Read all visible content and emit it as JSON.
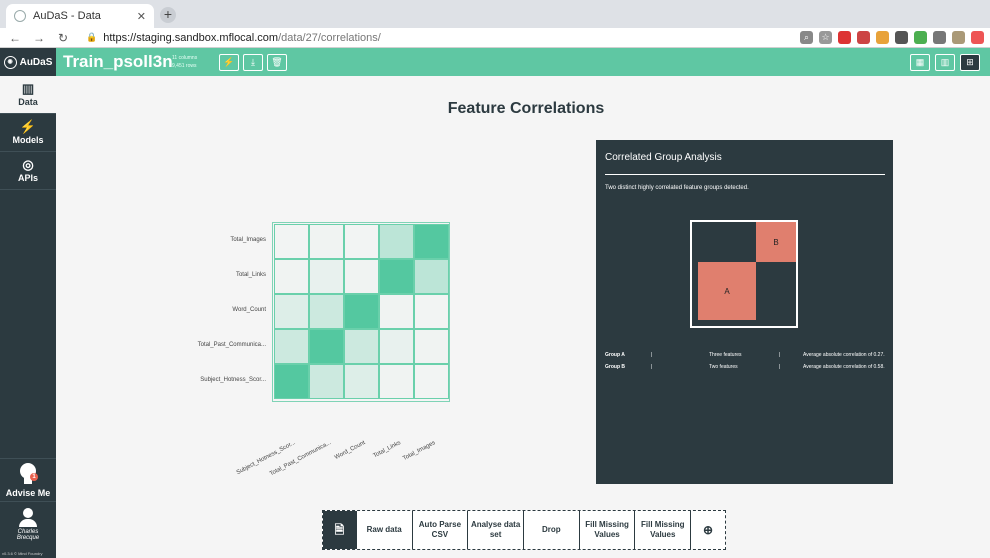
{
  "browser": {
    "tab_title": "AuDaS - Data",
    "url_host": "https://staging.sandbox.mflocal.com",
    "url_path": "/data/27/correlations/"
  },
  "app": {
    "logo": "AuDaS",
    "dataset_title": "Train_psoll3n",
    "meta_line1": "11 columns",
    "meta_line2": "9,451 rows",
    "header_buttons": [
      "bolt-icon",
      "download-icon",
      "trash-icon"
    ],
    "view_buttons": [
      "grid-icon",
      "chart-icon",
      "correlation-icon"
    ]
  },
  "sidebar": {
    "items": [
      {
        "label": "Data",
        "icon": "chart-icon"
      },
      {
        "label": "Models",
        "icon": "bolt-icon"
      },
      {
        "label": "APIs",
        "icon": "globe-icon"
      }
    ],
    "advise": "Advise Me",
    "advise_badge": "1",
    "user_line1": "Charles",
    "user_line2": "Brecque",
    "version": "v0.3.6 © Mind Foundry"
  },
  "main": {
    "title": "Feature Correlations"
  },
  "chart_data": {
    "type": "heatmap",
    "rows": [
      "Total_Images",
      "Total_Links",
      "Word_Count",
      "Total_Past_Communica...",
      "Subject_Hotness_Scor..."
    ],
    "columns": [
      "Subject_Hotness_Scor...",
      "Total_Past_Communica...",
      "Word_Count",
      "Total_Links",
      "Total_Images"
    ],
    "values": [
      [
        0.02,
        0.03,
        0.02,
        0.35,
        1.0
      ],
      [
        0.03,
        0.08,
        0.03,
        1.0,
        0.35
      ],
      [
        0.15,
        0.25,
        1.0,
        0.03,
        0.02
      ],
      [
        0.25,
        1.0,
        0.25,
        0.08,
        0.03
      ],
      [
        1.0,
        0.25,
        0.15,
        0.03,
        0.02
      ]
    ],
    "color": "#54c8a0"
  },
  "panel": {
    "title": "Correlated Group Analysis",
    "description": "Two distinct highly correlated feature groups detected.",
    "groups": [
      {
        "label": "A",
        "name": "Group A",
        "sep": "|",
        "count": "Three features",
        "sep2": "|",
        "avg": "Average absolute correlation of 0.27."
      },
      {
        "label": "B",
        "name": "Group B",
        "sep": "|",
        "count": "Two features",
        "sep2": "|",
        "avg": "Average absolute correlation of 0.58."
      }
    ],
    "group_color": "#e07f6e"
  },
  "pipeline": {
    "steps": [
      "Raw data",
      "Auto Parse CSV",
      "Analyse data set",
      "Drop",
      "Fill Missing Values",
      "Fill Missing Values"
    ]
  }
}
